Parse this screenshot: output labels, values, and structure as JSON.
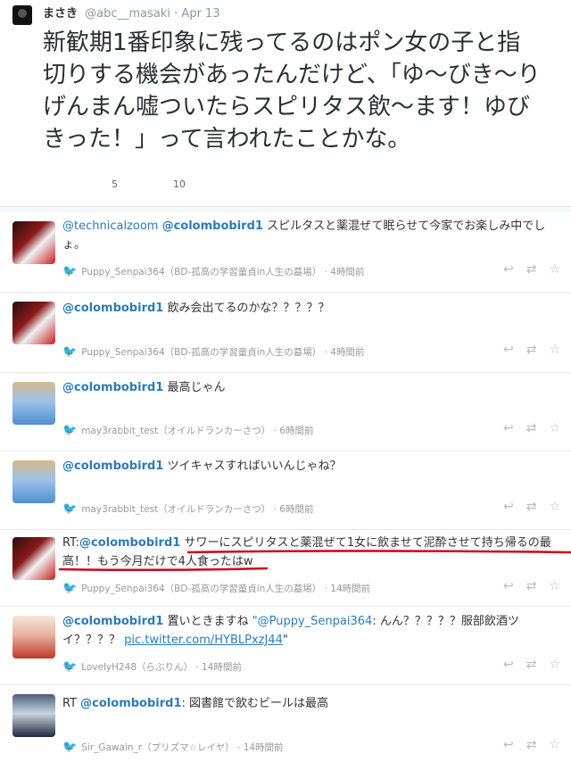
{
  "top": {
    "name": "まさき",
    "handle": "@abc__masaki",
    "date": "· Apr 13",
    "text": "新歓期1番印象に残ってるのはポン女の子と指切りする機会があったんだけど、「ゆ〜びき〜りげんまん嘘ついたらスピリタス飲〜ます！ゆびきった！」って言われたことかな。",
    "retweets": "5",
    "favorites": "10"
  },
  "tweets": [
    {
      "avatar": "red",
      "mention1": "@technicalzoom",
      "mention2": "@colombobird1",
      "text": "スピルタスと薬混ぜて眠らせて今家でお楽しみ中でしょ。",
      "via": "Puppy_Senpai364（BD-孤高の学習童貞in人生の墓場）",
      "time": "4時間前"
    },
    {
      "avatar": "red",
      "mention1": "@colombobird1",
      "text": "飲み会出てるのかな？？？？？",
      "via": "Puppy_Senpai364（BD-孤高の学習童貞in人生の墓場）",
      "time": "4時間前"
    },
    {
      "avatar": "blue",
      "mention1": "@colombobird1",
      "text": "最高じゃん",
      "via": "may3rabbit_test（オイルドランカーさつ）",
      "time": "6時間前"
    },
    {
      "avatar": "blue",
      "mention1": "@colombobird1",
      "text": "ツイキャスすればいいんじゃね？",
      "via": "may3rabbit_test（オイルドランカーさつ）",
      "time": "6時間前"
    },
    {
      "avatar": "red",
      "rt": "RT:",
      "mention1": "@colombobird1",
      "text": "サワーにスピリタスと薬混ぜて1女に飲ませて泥酔させて持ち帰るの最高！！もう今月だけで4人食ったはw",
      "via": "Puppy_Senpai364（BD-孤高の学習童貞in人生の墓場）",
      "time": "14時間前"
    },
    {
      "avatar": "lov",
      "mention1": "@colombobird1",
      "text_a": "置いときますね",
      "quote_mention": "\"@Puppy_Senpai364",
      "text_b": ": んん？？？？？服部飲酒ツイ？？？？",
      "link": "pic.twitter.com/HYBLPxzJ44",
      "text_c": "\"",
      "via": "LovelyH248（らぶりん）",
      "time": "14時間前"
    },
    {
      "avatar": "sir",
      "rt": "RT",
      "mention1": "@colombobird1",
      "text": ": 図書館で飲むビールは最高",
      "via": "Sir_Gawain_r（プリズマ☆レイヤ）",
      "time": "14時間前"
    }
  ],
  "icons": {
    "bird": "twitter-bird-icon",
    "reply": "reply-icon",
    "retweet": "retweet-icon",
    "favorite": "star-icon"
  },
  "colors": {
    "link": "#2b7bb9",
    "bird": "#55acee",
    "underline": "#d0021b"
  }
}
